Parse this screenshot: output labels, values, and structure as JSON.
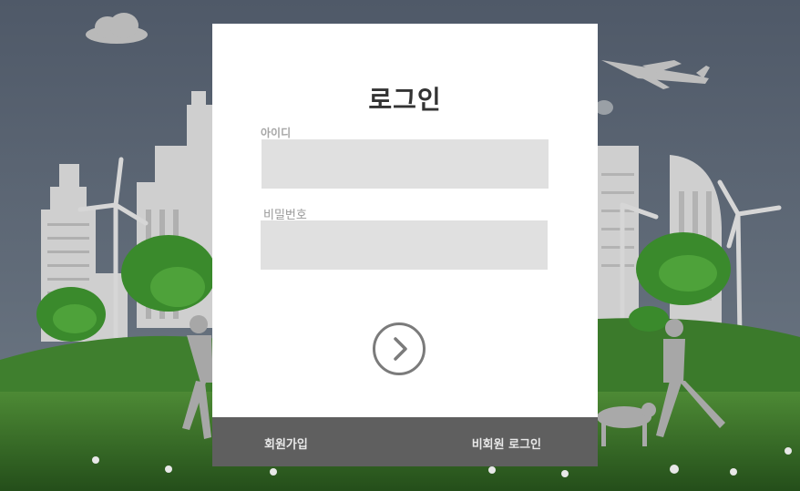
{
  "login": {
    "title": "로그인",
    "id_label": "아이디",
    "id_value": "",
    "password_label": "비밀번호",
    "password_value": ""
  },
  "footer": {
    "signup_label": "회원가입",
    "guest_login_label": "비회원 로그인"
  },
  "icons": {
    "submit": "chevron-right-circle-icon"
  },
  "colors": {
    "panel": "#ffffff",
    "field_background": "#e0e0e0",
    "footer_background": "#5f5f5f",
    "sky": "#56616f",
    "grass": "#3d7a2c"
  }
}
